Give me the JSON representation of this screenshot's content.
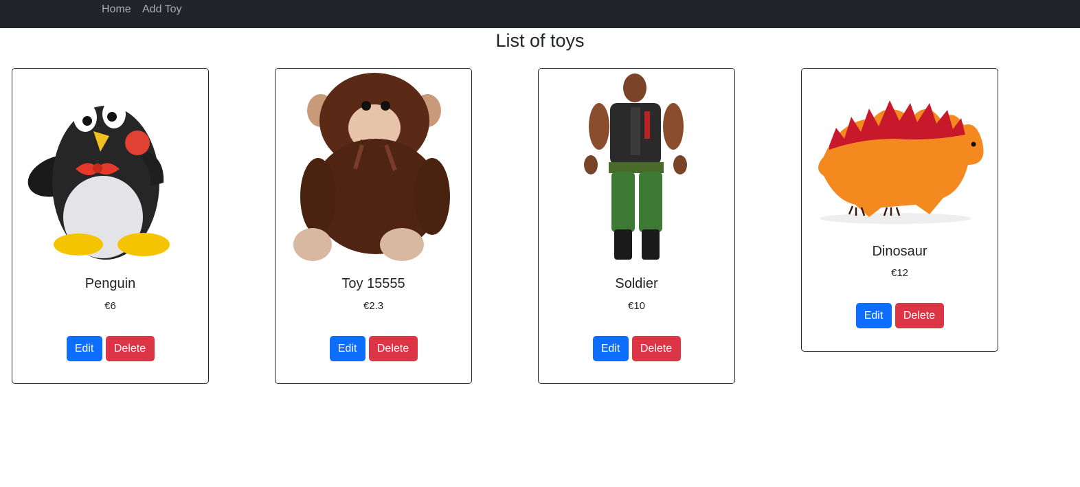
{
  "nav": {
    "home_label": "Home",
    "add_toy_label": "Add Toy",
    "background": "#212529"
  },
  "page": {
    "title": "List of toys"
  },
  "toys": [
    {
      "name": "Penguin",
      "price": "€6",
      "edit_label": "Edit",
      "delete_label": "Delete"
    },
    {
      "name": "Toy 15555",
      "price": "€2.3",
      "edit_label": "Edit",
      "delete_label": "Delete"
    },
    {
      "name": "Soldier",
      "price": "€10",
      "edit_label": "Edit",
      "delete_label": "Delete"
    },
    {
      "name": "Dinosaur",
      "price": "€12",
      "edit_label": "Edit",
      "delete_label": "Delete"
    }
  ],
  "colors": {
    "edit_button": "#0d6efd",
    "delete_button": "#dc3545"
  }
}
